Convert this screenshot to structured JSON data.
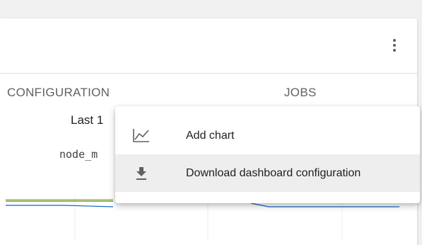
{
  "card": {
    "more_menu_icon": "more-vertical-icon"
  },
  "tabs": [
    {
      "label": "CONFIGURATION"
    },
    {
      "label": "JOBS"
    }
  ],
  "chart": {
    "title_partial": "Last 1",
    "subtitle_partial": "node_m",
    "colors": {
      "orange": "#e6a135",
      "green": "#4caf50",
      "blue": "#1565c0"
    }
  },
  "menu": {
    "items": [
      {
        "label": "Add chart",
        "icon": "line-chart-icon"
      },
      {
        "label": "Download dashboard configuration",
        "icon": "download-icon"
      }
    ]
  }
}
